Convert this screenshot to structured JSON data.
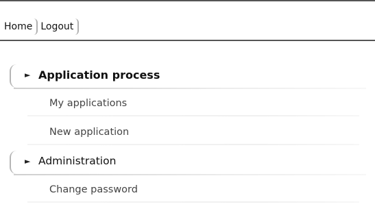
{
  "topnav": {
    "home_label": "Home",
    "logout_label": "Logout"
  },
  "menu": {
    "sections": [
      {
        "title": "Application process",
        "expanded_marker": "►",
        "items": [
          {
            "label": "My applications"
          },
          {
            "label": "New application"
          }
        ]
      },
      {
        "title": "Administration",
        "expanded_marker": "►",
        "items": [
          {
            "label": "Change password"
          }
        ]
      }
    ]
  }
}
